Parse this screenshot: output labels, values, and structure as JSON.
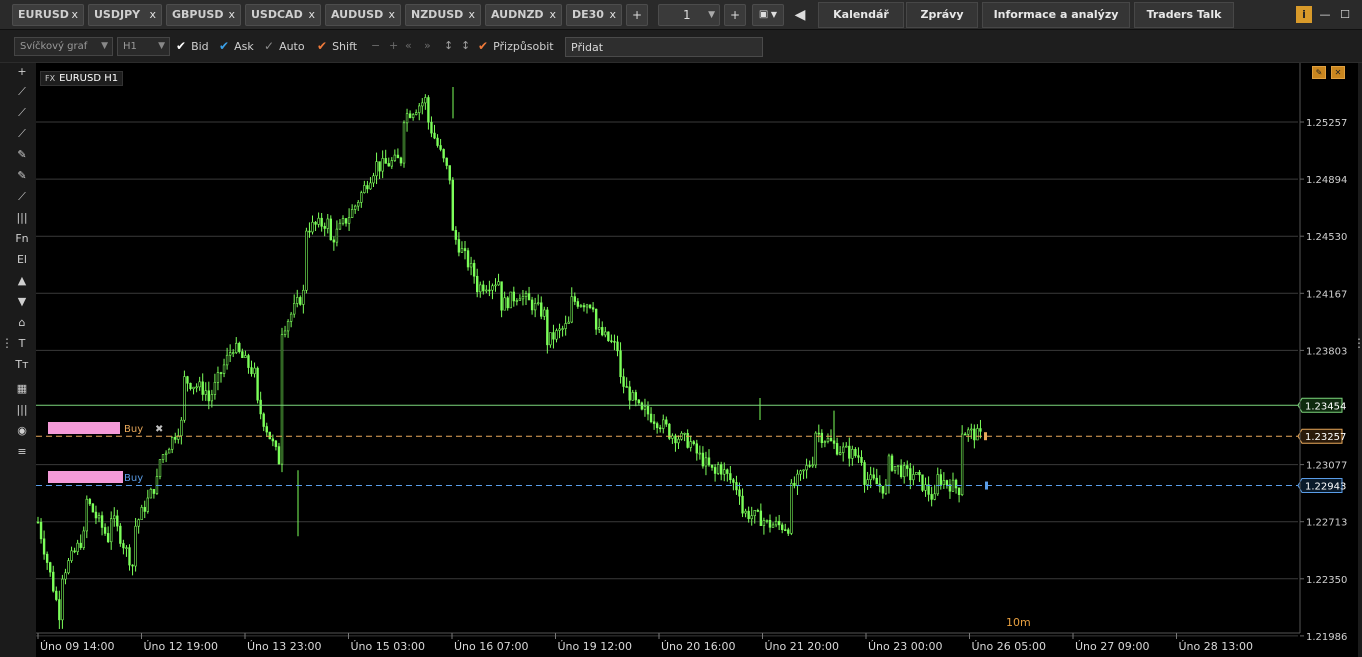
{
  "tabs": [
    {
      "label": "EURUSD",
      "close": "x"
    },
    {
      "label": "USDJPY",
      "close": "x"
    },
    {
      "label": "GBPUSD",
      "close": "x"
    },
    {
      "label": "USDCAD",
      "close": "x"
    },
    {
      "label": "AUDUSD",
      "close": "x"
    },
    {
      "label": "NZDUSD",
      "close": "x"
    },
    {
      "label": "AUDNZD",
      "close": "x"
    },
    {
      "label": "DE30",
      "close": "x"
    }
  ],
  "topbar": {
    "add_tab": "+",
    "quantity": "1",
    "plus": "+",
    "back_icon": "arrow-left-icon",
    "nav": [
      "Kalendář",
      "Zprávy",
      "Informace a analýzy",
      "Traders Talk"
    ],
    "window_controls": {
      "info": "i",
      "minimize": "—",
      "maximize": "☐"
    }
  },
  "toolbar": {
    "chart_type": "Svíčkový graf",
    "timeframe": "H1",
    "bid": "Bid",
    "ask": "Ask",
    "auto": "Auto",
    "shift": "Shift",
    "fit": "Přizpůsobit",
    "add_placeholder": "Přidat"
  },
  "left_tools": [
    "+",
    "⟋",
    "⟋",
    "⟋",
    "✎",
    "✎",
    "⟋",
    "|||",
    "Fn",
    "El",
    "▲",
    "▼",
    "⌂",
    "T",
    "Tт",
    "▦",
    "|||",
    "◉",
    "≡"
  ],
  "chart": {
    "instrument_prefix": "FX",
    "instrument": "EURUSD H1",
    "timer": "10m",
    "colors": {
      "candle": "#7cff5a",
      "bid_line": "#7cd67c",
      "order_orange": "#e8a85a",
      "order_blue": "#5a9de8",
      "buy_box": "#f49ad8"
    },
    "orders": [
      {
        "label": "Buy",
        "price": 1.23257,
        "color": "#e8a85a",
        "close": "✖"
      },
      {
        "label": "Buy",
        "price": 1.22943,
        "color": "#5a9de8",
        "close": ""
      }
    ],
    "current_price": "1.23454",
    "price_tags": [
      "1.23454",
      "1.23257",
      "1.22943"
    ]
  },
  "chart_data": {
    "type": "candlestick",
    "y_ticks": [
      "1.25257",
      "1.24894",
      "1.24530",
      "1.24167",
      "1.23803",
      "1.23077",
      "1.22713",
      "1.22350",
      "1.21986"
    ],
    "x_ticks": [
      "Úno 09 14:00",
      "Úno 12 19:00",
      "Úno 13 23:00",
      "Úno 15 03:00",
      "Úno 16 07:00",
      "Úno 19 12:00",
      "Úno 20 16:00",
      "Úno 21 20:00",
      "Úno 23 00:00",
      "Úno 26 05:00",
      "Úno 27 09:00",
      "Úno 28 13:00"
    ],
    "ylim": [
      1.21986,
      1.25257
    ],
    "close_path": [
      [
        1.2271,
        1.2205
      ],
      [
        1.2238,
        1.2265
      ],
      [
        1.2285,
        1.2258
      ],
      [
        1.2276,
        1.224
      ],
      [
        1.2268,
        1.23
      ],
      [
        1.231,
        1.2336
      ],
      [
        1.2362,
        1.2354
      ],
      [
        1.2347,
        1.2382
      ],
      [
        1.2384,
        1.2364
      ],
      [
        1.2348,
        1.2308
      ],
      [
        1.2392,
        1.2418
      ],
      [
        1.2458,
        1.2462
      ],
      [
        1.2448,
        1.247
      ],
      [
        1.247,
        1.25
      ],
      [
        1.2497,
        1.2502
      ],
      [
        1.2528,
        1.254
      ],
      [
        1.253,
        1.249
      ],
      [
        1.2458,
        1.2428
      ],
      [
        1.242,
        1.2425
      ],
      [
        1.2408,
        1.2418
      ],
      [
        1.2414,
        1.2402
      ],
      [
        1.2386,
        1.2398
      ],
      [
        1.2412,
        1.241
      ],
      [
        1.2394,
        1.238
      ],
      [
        1.2362,
        1.2338
      ],
      [
        1.2342,
        1.233
      ],
      [
        1.2328,
        1.2321
      ],
      [
        1.2318,
        1.23
      ],
      [
        1.2308,
        1.229
      ],
      [
        1.2278,
        1.2272
      ],
      [
        1.227,
        1.2268
      ],
      [
        1.229,
        1.2312
      ],
      [
        1.233,
        1.2318
      ],
      [
        1.2318,
        1.2312
      ],
      [
        1.23,
        1.2292
      ],
      [
        1.231,
        1.23
      ],
      [
        1.2304,
        1.2285
      ],
      [
        1.23,
        1.2292
      ],
      [
        1.233,
        1.2325
      ]
    ]
  }
}
